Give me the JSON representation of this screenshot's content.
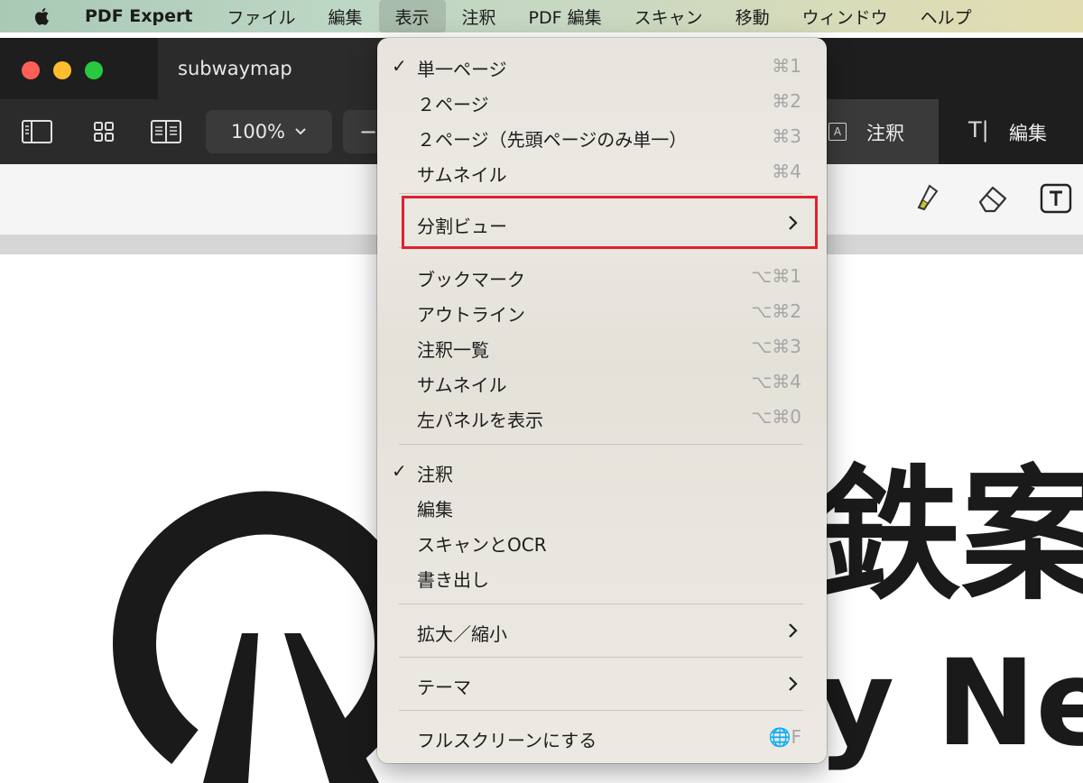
{
  "menubar": {
    "app_name": "PDF Expert",
    "items": [
      "ファイル",
      "編集",
      "表示",
      "注釈",
      "PDF 編集",
      "スキャン",
      "移動",
      "ウィンドウ",
      "ヘルプ"
    ],
    "active_item": "表示"
  },
  "window": {
    "doc_title": "subwaymap"
  },
  "toolbar": {
    "zoom_value": "100%",
    "zoom_out": "−",
    "mode_annotate": "注釈",
    "mode_edit": "編集"
  },
  "menu": {
    "items": [
      {
        "label": "単一ページ",
        "shortcut": "⌘1",
        "checked": true
      },
      {
        "label": "２ページ",
        "shortcut": "⌘2"
      },
      {
        "label": "２ページ（先頭ページのみ単一）",
        "shortcut": "⌘3"
      },
      {
        "label": "サムネイル",
        "shortcut": "⌘4"
      },
      {
        "label": "分割ビュー",
        "submenu": true,
        "highlighted": true
      },
      {
        "label": "ブックマーク",
        "shortcut": "⌥⌘1"
      },
      {
        "label": "アウトライン",
        "shortcut": "⌥⌘2"
      },
      {
        "label": "注釈一覧",
        "shortcut": "⌥⌘3"
      },
      {
        "label": "サムネイル",
        "shortcut": "⌥⌘4"
      },
      {
        "label": "左パネルを表示",
        "shortcut": "⌥⌘0"
      },
      {
        "label": "注釈",
        "checked": true
      },
      {
        "label": "編集"
      },
      {
        "label": "スキャンとOCR"
      },
      {
        "label": "書き出し"
      },
      {
        "label": "拡大／縮小",
        "submenu": true
      },
      {
        "label": "テーマ",
        "submenu": true
      },
      {
        "label": "フルスクリーンにする",
        "shortcut": "🌐F"
      }
    ]
  },
  "document": {
    "title_kanji": "鉄案",
    "title_latin": "y Netv"
  },
  "colors": {
    "highlight_box": "#e0212e",
    "titlebar": "#1e1e1e",
    "toolbar": "#2b2b2b"
  }
}
